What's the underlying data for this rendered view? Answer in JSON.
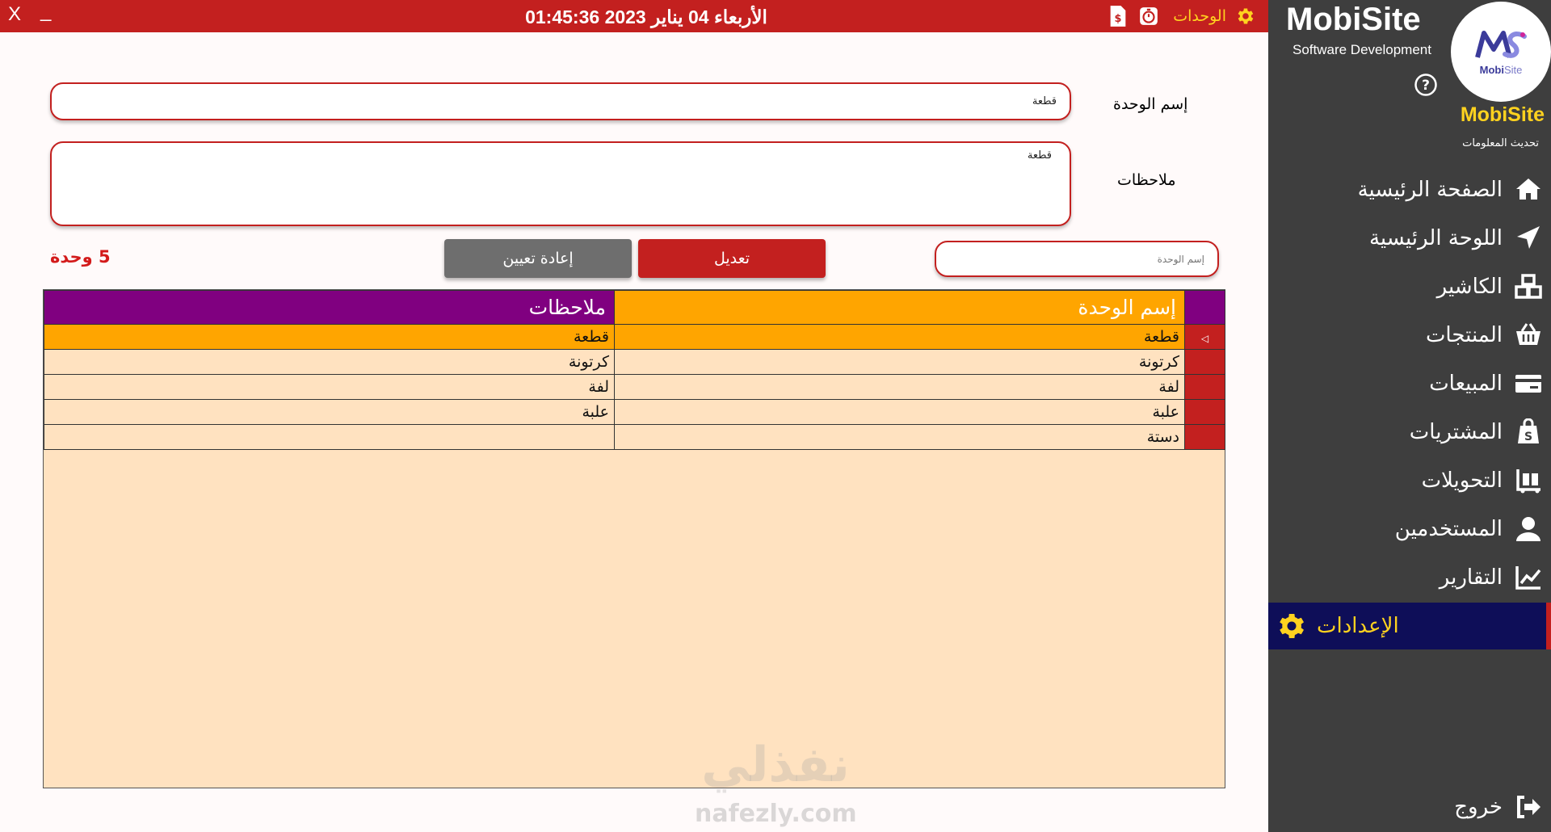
{
  "window": {
    "close_label": "X",
    "minimize_label": "_"
  },
  "header": {
    "datetime": "الأربعاء 04 يناير 2023 01:45:36",
    "section_label": "الوحدات",
    "section_icon": "gear-icon",
    "icons": [
      "timer-icon",
      "price-document-icon"
    ]
  },
  "form": {
    "unit_name_label": "إسم الوحدة",
    "unit_name_value": "قطعة",
    "notes_label": "ملاحظات",
    "notes_value": "قطعة",
    "search_placeholder": "إسم الوحدة",
    "edit_button": "تعديل",
    "reset_button": "إعادة تعيين",
    "count_label": "5 وحدة"
  },
  "table": {
    "headers": {
      "name": "إسم الوحدة",
      "notes": "ملاحظات"
    },
    "rows": [
      {
        "name": "قطعة",
        "notes": "قطعة",
        "selected": true
      },
      {
        "name": "كرتونة",
        "notes": "كرتونة",
        "selected": false
      },
      {
        "name": "لفة",
        "notes": "لفة",
        "selected": false
      },
      {
        "name": "علبة",
        "notes": "علبة",
        "selected": false
      },
      {
        "name": "دستة",
        "notes": "",
        "selected": false
      }
    ]
  },
  "sidebar": {
    "brand_title": "MobiSite",
    "brand_subtitle": "Software Development",
    "logo_caption_bold": "Mobi",
    "logo_caption_light": "Site",
    "brand_name": "MobiSite",
    "update_label": "تحديث المعلومات",
    "items": [
      {
        "label": "الصفحة الرئيسية",
        "icon": "home-icon"
      },
      {
        "label": "اللوحة الرئيسية",
        "icon": "paper-plane-icon"
      },
      {
        "label": "الكاشير",
        "icon": "boxes-icon"
      },
      {
        "label": "المنتجات",
        "icon": "basket-icon"
      },
      {
        "label": "المبيعات",
        "icon": "credit-card-icon"
      },
      {
        "label": "المشتريات",
        "icon": "shopping-bag-icon"
      },
      {
        "label": "التحويلات",
        "icon": "dolly-icon"
      },
      {
        "label": "المستخدمين",
        "icon": "user-icon"
      },
      {
        "label": "التقارير",
        "icon": "chart-line-icon"
      },
      {
        "label": "الإعدادات",
        "icon": "gear-icon",
        "active": true
      }
    ],
    "logout_label": "خروج"
  },
  "watermark": {
    "arabic": "نفذلي",
    "latin": "nafezly.com"
  },
  "colors": {
    "primary_red": "#c3201f",
    "sidebar_bg": "#3e3e3e",
    "accent_yellow": "#ffd21f",
    "header_purple": "#800080",
    "header_orange": "#ffa500",
    "grid_bg": "#ffe2c0",
    "active_nav_bg": "#0e0e58"
  }
}
